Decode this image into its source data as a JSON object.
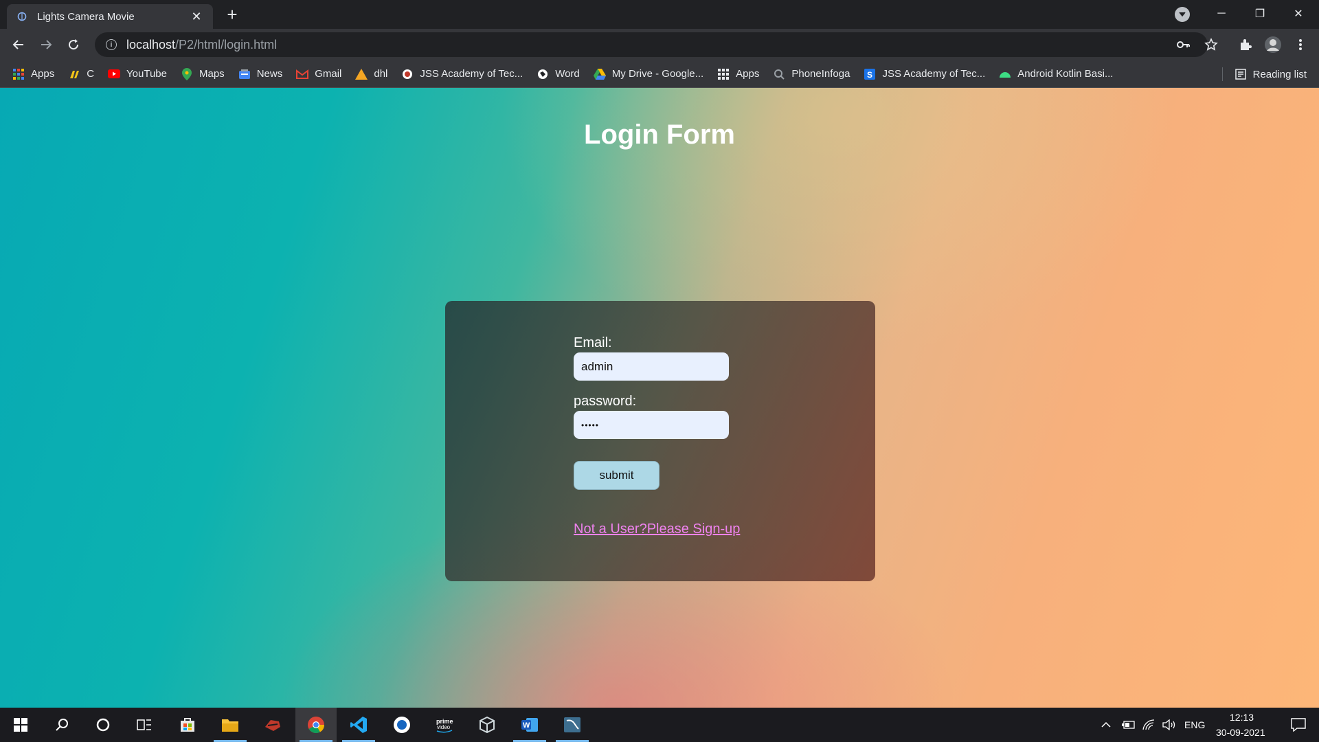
{
  "browser": {
    "tab_title": "Lights Camera Movie",
    "tab_close": "✕",
    "new_tab": "+",
    "url_host": "localhost",
    "url_path": "/P2/html/login.html",
    "window_controls": {
      "minimize": "─",
      "restore": "❐",
      "close": "✕"
    }
  },
  "bookmarks": [
    {
      "label": "Apps",
      "icon": "apps-grid-icon"
    },
    {
      "label": "C",
      "icon": "codechef-icon"
    },
    {
      "label": "YouTube",
      "icon": "youtube-icon"
    },
    {
      "label": "Maps",
      "icon": "maps-pin-icon"
    },
    {
      "label": "News",
      "icon": "news-icon"
    },
    {
      "label": "Gmail",
      "icon": "gmail-icon"
    },
    {
      "label": "dhl",
      "icon": "dhl-triangle-icon"
    },
    {
      "label": "JSS Academy of Tec...",
      "icon": "jss-logo-icon"
    },
    {
      "label": "Word",
      "icon": "word-globe-icon"
    },
    {
      "label": "My Drive - Google...",
      "icon": "google-drive-icon"
    },
    {
      "label": "Apps",
      "icon": "apps-grid-icon"
    },
    {
      "label": "PhoneInfoga",
      "icon": "phoneinfoga-icon"
    },
    {
      "label": "JSS Academy of Tec...",
      "icon": "jss-s-icon"
    },
    {
      "label": "Android Kotlin Basi...",
      "icon": "android-icon"
    }
  ],
  "reading_list": "Reading list",
  "page": {
    "title": "Login Form",
    "email_label": "Email:",
    "email_value": "admin",
    "password_label": "password:",
    "password_value": "•••••",
    "submit_label": "submit",
    "signup_link": "Not a User?Please Sign-up"
  },
  "taskbar": {
    "language": "ENG",
    "time": "12:13",
    "date": "30-09-2021"
  },
  "colors": {
    "accent_link": "#ee82ee",
    "button_bg": "#add8e6",
    "input_bg": "#e8f0fe"
  }
}
